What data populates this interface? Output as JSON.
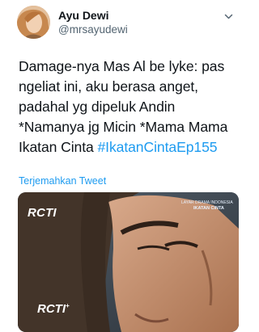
{
  "user": {
    "name": "Ayu Dewi",
    "handle": "@mrsayudewi"
  },
  "tweet": {
    "text_main": "Damage-nya Mas Al be lyke: pas ngeliat ini, aku berasa anget, padahal yg dipeluk Andin *Namanya jg Micin *Mama Mama Ikatan Cinta ",
    "hashtag": "#IkatanCintaEp155",
    "translate_label": "Terjemahkan Tweet"
  },
  "media": {
    "top_watermark": "RCTI",
    "bottom_watermark": "RCTI",
    "bottom_watermark_sup": "+",
    "brand_small": "LAYAR DRAMA INDONESIA",
    "brand_title": "IKATAN CINTA"
  },
  "icons": {
    "more": "chevron-down-icon"
  },
  "colors": {
    "link": "#1d9bf0",
    "handle": "#536471",
    "text": "#0f1419"
  }
}
